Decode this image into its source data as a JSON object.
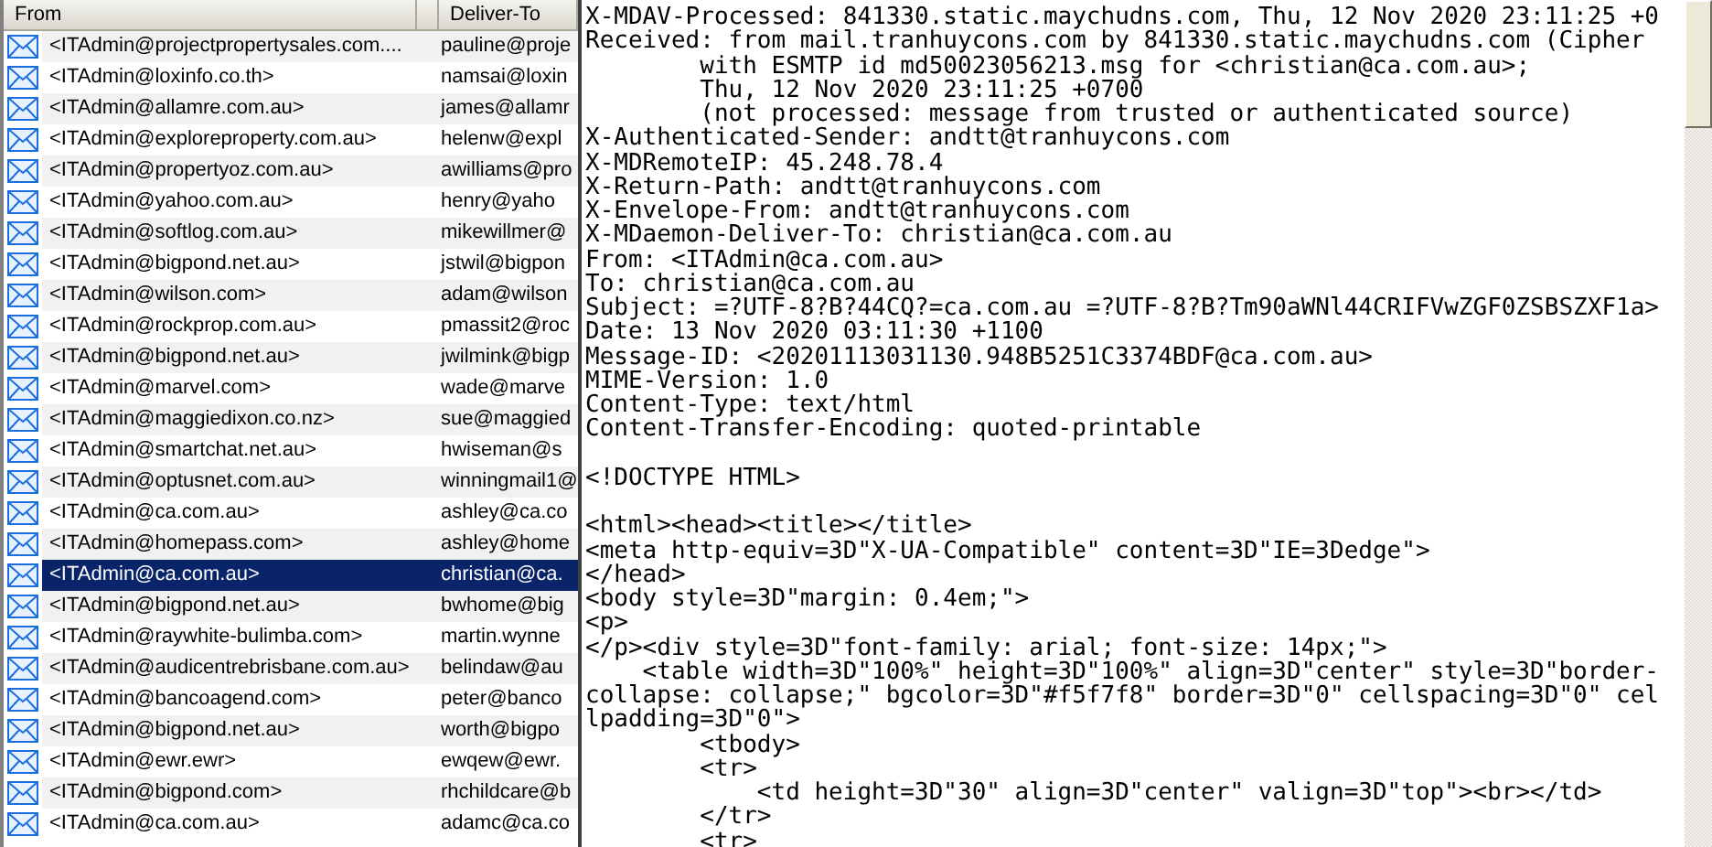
{
  "message_list": {
    "columns": [
      {
        "label": "From"
      },
      {
        "label": "Deliver-To"
      }
    ],
    "rows": [
      {
        "from": "<ITAdmin@projectpropertysales.com....",
        "deliver_to": "pauline@proje",
        "selected": false
      },
      {
        "from": "<ITAdmin@loxinfo.co.th>",
        "deliver_to": "namsai@loxin",
        "selected": false
      },
      {
        "from": "<ITAdmin@allamre.com.au>",
        "deliver_to": "james@allamr",
        "selected": false
      },
      {
        "from": "<ITAdmin@exploreproperty.com.au>",
        "deliver_to": "helenw@expl",
        "selected": false
      },
      {
        "from": "<ITAdmin@propertyoz.com.au>",
        "deliver_to": "awilliams@pro",
        "selected": false
      },
      {
        "from": "<ITAdmin@yahoo.com.au>",
        "deliver_to": "henry@yaho",
        "selected": false
      },
      {
        "from": "<ITAdmin@softlog.com.au>",
        "deliver_to": "mikewillmer@",
        "selected": false
      },
      {
        "from": "<ITAdmin@bigpond.net.au>",
        "deliver_to": "jstwil@bigpon",
        "selected": false
      },
      {
        "from": "<ITAdmin@wilson.com>",
        "deliver_to": "adam@wilson",
        "selected": false
      },
      {
        "from": "<ITAdmin@rockprop.com.au>",
        "deliver_to": "pmassit2@roc",
        "selected": false
      },
      {
        "from": "<ITAdmin@bigpond.net.au>",
        "deliver_to": "jwilmink@bigp",
        "selected": false
      },
      {
        "from": "<ITAdmin@marvel.com>",
        "deliver_to": "wade@marve",
        "selected": false
      },
      {
        "from": "<ITAdmin@maggiedixon.co.nz>",
        "deliver_to": "sue@maggied",
        "selected": false
      },
      {
        "from": "<ITAdmin@smartchat.net.au>",
        "deliver_to": "hwiseman@s",
        "selected": false
      },
      {
        "from": "<ITAdmin@optusnet.com.au>",
        "deliver_to": "winningmail1@",
        "selected": false
      },
      {
        "from": "<ITAdmin@ca.com.au>",
        "deliver_to": "ashley@ca.co",
        "selected": false
      },
      {
        "from": "<ITAdmin@homepass.com>",
        "deliver_to": "ashley@home",
        "selected": false
      },
      {
        "from": "<ITAdmin@ca.com.au>",
        "deliver_to": "christian@ca.",
        "selected": true
      },
      {
        "from": "<ITAdmin@bigpond.net.au>",
        "deliver_to": "bwhome@big",
        "selected": false
      },
      {
        "from": "<ITAdmin@raywhite-bulimba.com>",
        "deliver_to": "martin.wynne",
        "selected": false
      },
      {
        "from": "<ITAdmin@audicentrebrisbane.com.au>",
        "deliver_to": "belindaw@au",
        "selected": false
      },
      {
        "from": "<ITAdmin@bancoagend.com>",
        "deliver_to": "peter@banco",
        "selected": false
      },
      {
        "from": "<ITAdmin@bigpond.net.au>",
        "deliver_to": "worth@bigpo",
        "selected": false
      },
      {
        "from": "<ITAdmin@ewr.ewr>",
        "deliver_to": "ewqew@ewr.",
        "selected": false
      },
      {
        "from": "<ITAdmin@bigpond.com>",
        "deliver_to": "rhchildcare@b",
        "selected": false
      },
      {
        "from": "<ITAdmin@ca.com.au>",
        "deliver_to": "adamc@ca.co",
        "selected": false
      }
    ]
  },
  "message_source": {
    "blocks": [
      [
        "X-MDAV-Processed: 841330.static.maychudns.com, Thu, 12 Nov 2020 23:11:25 +0",
        "Received: from mail.tranhuycons.com by 841330.static.maychudns.com (Cipher",
        "        with ESMTP id md50023056213.msg for <christian@ca.com.au>;",
        "        Thu, 12 Nov 2020 23:11:25 +0700",
        "        (not processed: message from trusted or authenticated source)",
        "X-Authenticated-Sender: andtt@tranhuycons.com",
        "X-MDRemoteIP: 45.248.78.4",
        "X-Return-Path: andtt@tranhuycons.com",
        "X-Envelope-From: andtt@tranhuycons.com",
        "X-MDaemon-Deliver-To: christian@ca.com.au",
        "From: <ITAdmin@ca.com.au>",
        "To: christian@ca.com.au",
        "Subject: =?UTF-8?B?44CQ?=ca.com.au =?UTF-8?B?Tm90aWNl44CRIFVwZGF0ZSBSZXF1a>",
        "Date: 13 Nov 2020 03:11:30 +1100",
        "Message-ID: <20201113031130.948B5251C3374BDF@ca.com.au>",
        "MIME-Version: 1.0",
        "Content-Type: text/html",
        "Content-Transfer-Encoding: quoted-printable"
      ],
      [
        "<!DOCTYPE HTML>"
      ],
      [
        "<html><head><title></title>",
        "<meta http-equiv=3D\"X-UA-Compatible\" content=3D\"IE=3Dedge\">",
        "</head>",
        "<body style=3D\"margin: 0.4em;\">",
        "<p>",
        "</p><div style=3D\"font-family: arial; font-size: 14px;\">",
        "    <table width=3D\"100%\" height=3D\"100%\" align=3D\"center\" style=3D\"border-",
        "collapse: collapse;\" bgcolor=3D\"#f5f7f8\" border=3D\"0\" cellspacing=3D\"0\" cel",
        "lpadding=3D\"0\">",
        "        <tbody>",
        "        <tr>",
        "            <td height=3D\"30\" align=3D\"center\" valign=3D\"top\"><br></td>",
        "        </tr>",
        "        <tr>"
      ]
    ]
  }
}
